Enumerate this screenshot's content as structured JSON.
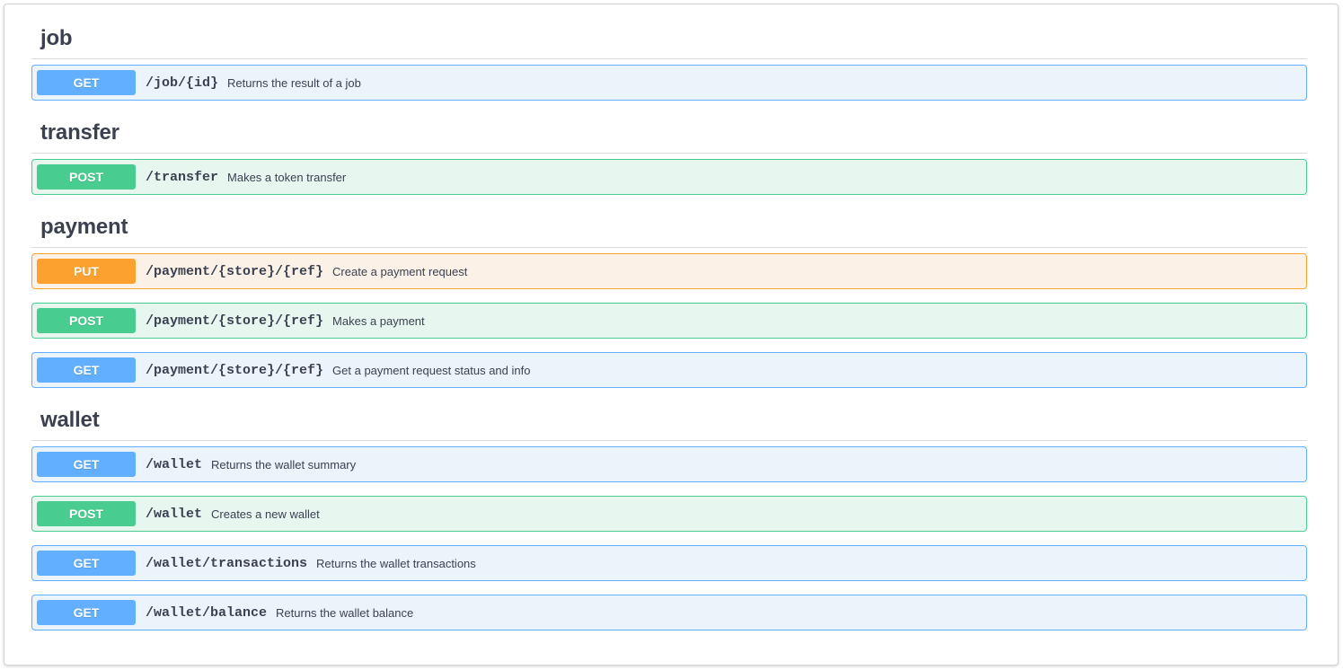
{
  "colors": {
    "get": "#61affe",
    "post": "#49cc90",
    "put": "#fca130",
    "get_bg": "#ebf3fb",
    "post_bg": "#e8f6f0",
    "put_bg": "#fbf1e6",
    "text": "#3b4151"
  },
  "tags": [
    {
      "name": "job",
      "operations": [
        {
          "method": "GET",
          "path": "/job/{id}",
          "summary": "Returns the result of a job"
        }
      ]
    },
    {
      "name": "transfer",
      "operations": [
        {
          "method": "POST",
          "path": "/transfer",
          "summary": "Makes a token transfer"
        }
      ]
    },
    {
      "name": "payment",
      "operations": [
        {
          "method": "PUT",
          "path": "/payment/{store}/{ref}",
          "summary": "Create a payment request"
        },
        {
          "method": "POST",
          "path": "/payment/{store}/{ref}",
          "summary": "Makes a payment"
        },
        {
          "method": "GET",
          "path": "/payment/{store}/{ref}",
          "summary": "Get a payment request status and info"
        }
      ]
    },
    {
      "name": "wallet",
      "operations": [
        {
          "method": "GET",
          "path": "/wallet",
          "summary": "Returns the wallet summary"
        },
        {
          "method": "POST",
          "path": "/wallet",
          "summary": "Creates a new wallet"
        },
        {
          "method": "GET",
          "path": "/wallet/transactions",
          "summary": "Returns the wallet transactions"
        },
        {
          "method": "GET",
          "path": "/wallet/balance",
          "summary": "Returns the wallet balance"
        }
      ]
    }
  ]
}
